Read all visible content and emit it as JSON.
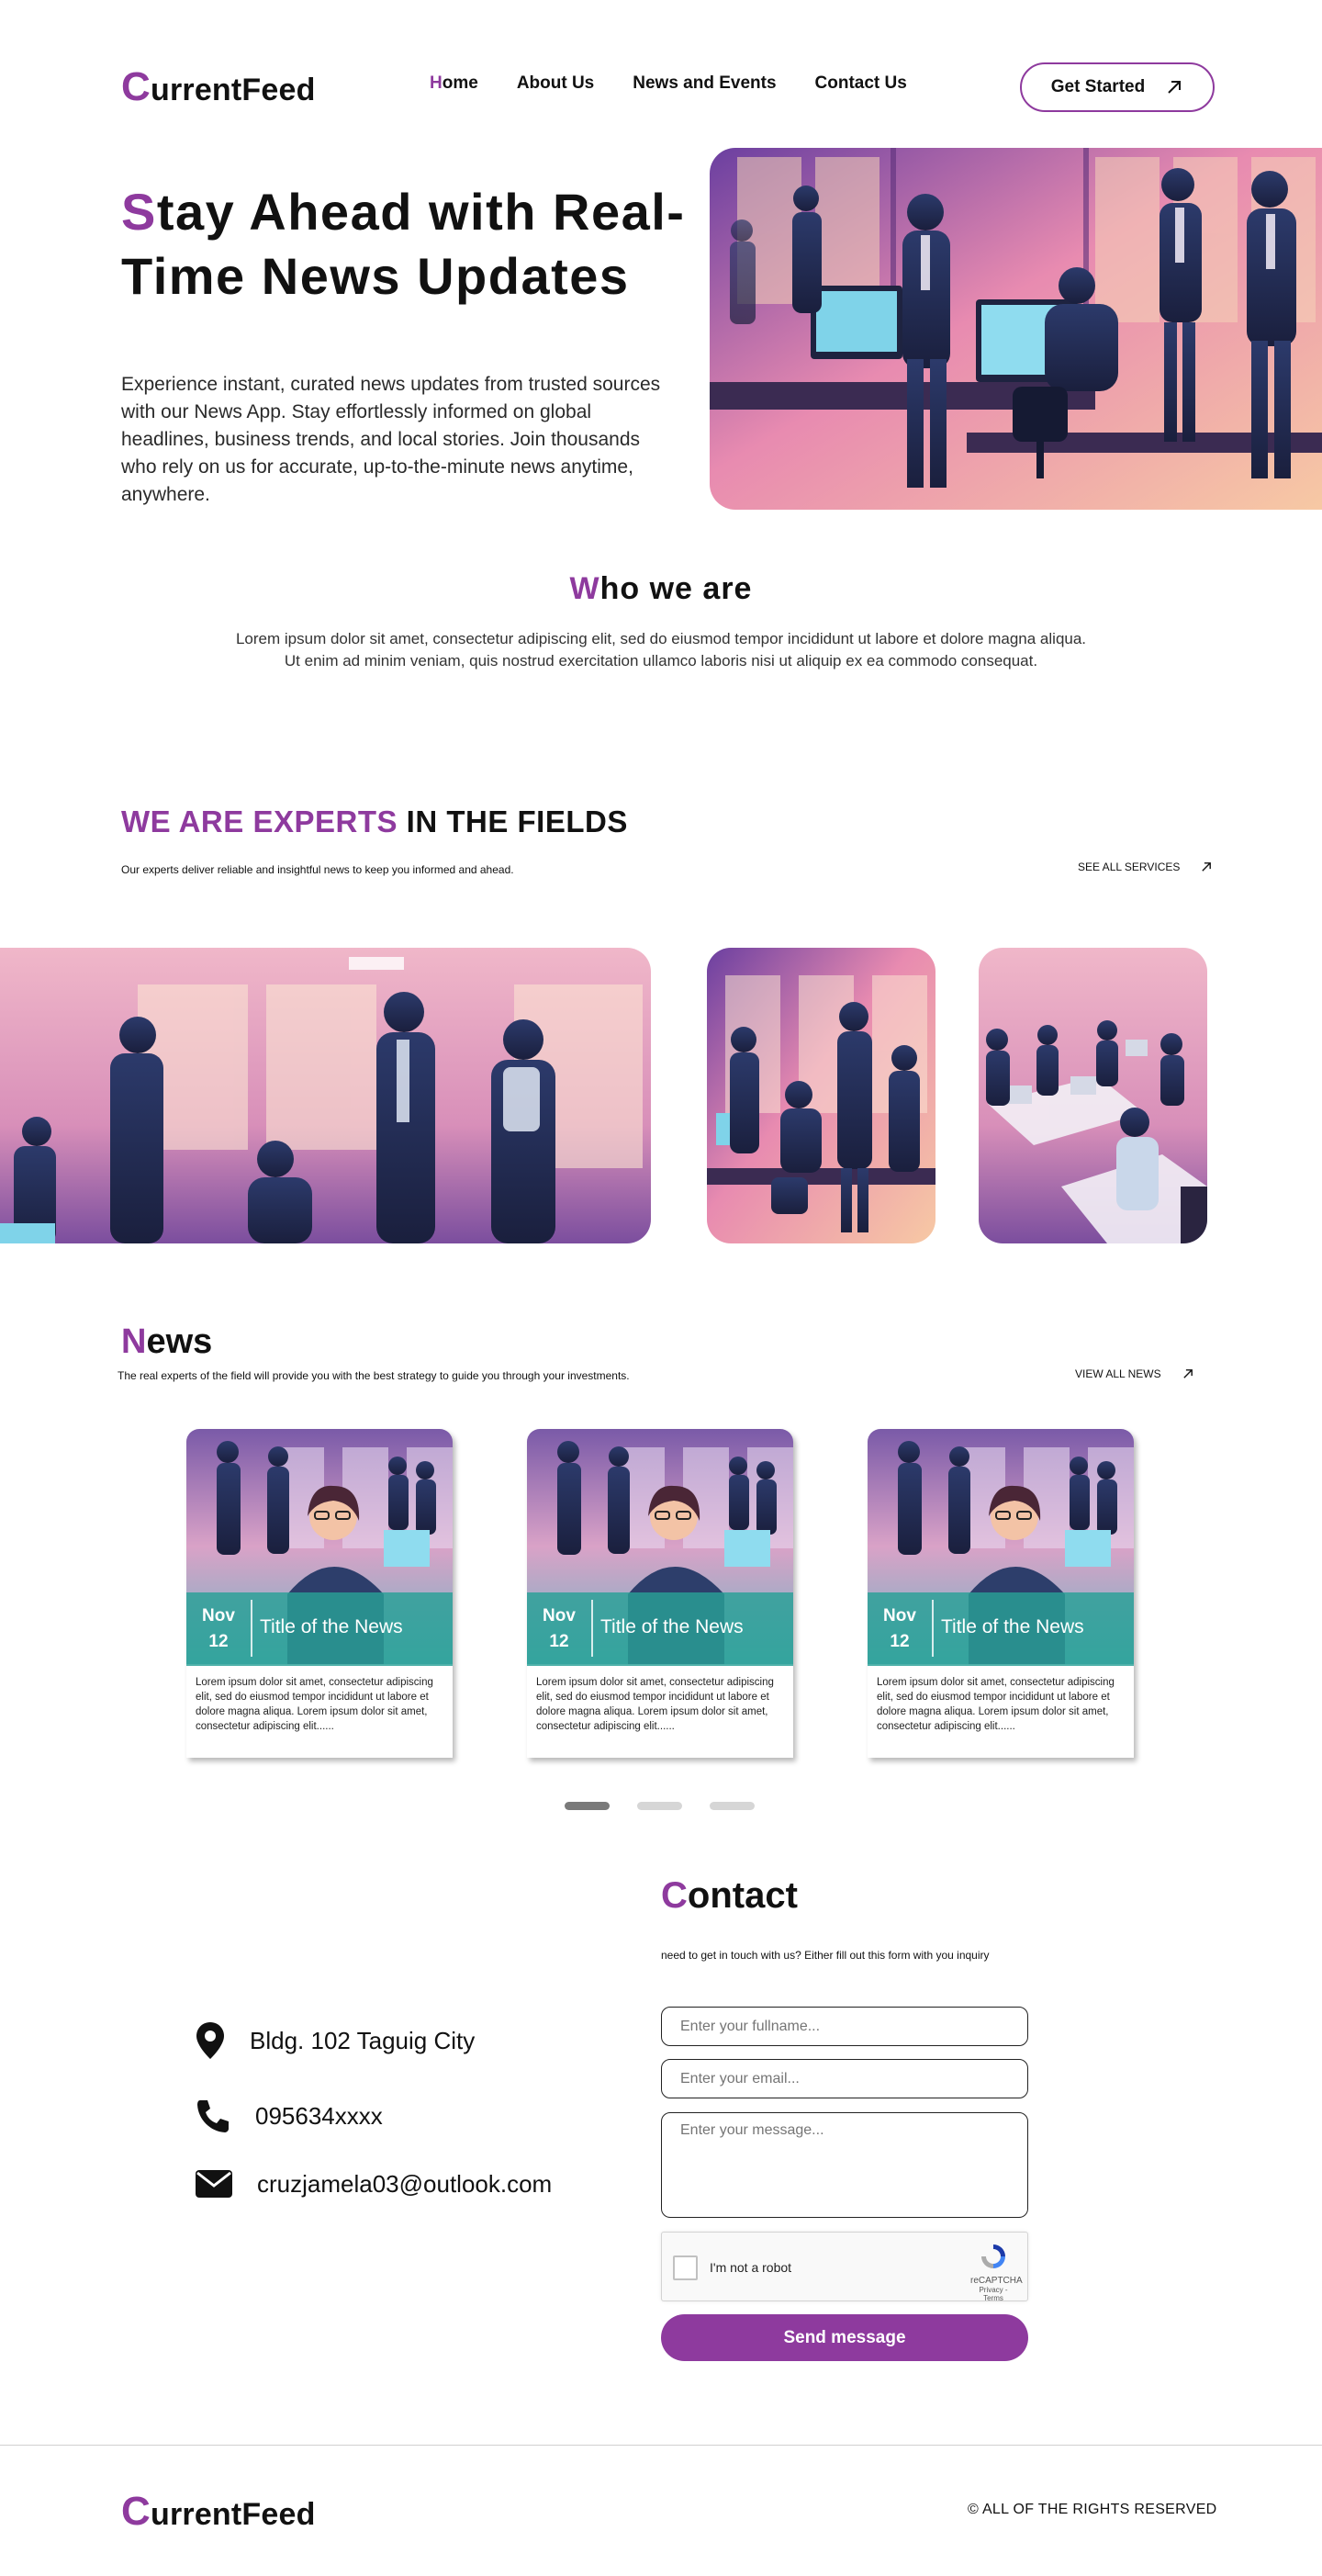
{
  "brand": {
    "first_letter": "C",
    "rest": "urrentFeed"
  },
  "nav": {
    "items": [
      {
        "first": "H",
        "rest": "ome"
      },
      {
        "first": "",
        "rest": "About Us"
      },
      {
        "first": "",
        "rest": "News and Events"
      },
      {
        "first": "",
        "rest": "Contact Us"
      }
    ],
    "cta_label": "Get Started"
  },
  "hero": {
    "title_first": "S",
    "title_rest": "tay Ahead with Real-Time News Updates",
    "description": "Experience instant, curated news updates from trusted sources with our News App. Stay effortlessly informed on global headlines, business trends, and local stories. Join thousands who rely on us for accurate, up-to-the-minute news anytime, anywhere."
  },
  "who": {
    "title_first": "W",
    "title_rest": "ho we are",
    "text": "Lorem ipsum dolor sit amet, consectetur adipiscing elit, sed do eiusmod tempor incididunt ut labore et dolore magna aliqua. Ut enim ad minim veniam, quis nostrud exercitation ullamco laboris nisi ut aliquip ex ea commodo consequat."
  },
  "experts": {
    "title_highlight": "WE ARE EXPERTS",
    "title_rest": " IN THE FIELDS",
    "subtitle": "Our experts deliver reliable and insightful news to keep you informed and ahead.",
    "link_label": "SEE ALL SERVICES"
  },
  "news": {
    "title_first": "N",
    "title_rest": "ews",
    "subtitle": "The real experts of the field will provide you with the best strategy to guide you through your investments.",
    "link_label": "VIEW ALL NEWS",
    "cards": [
      {
        "month": "Nov",
        "day": "12",
        "title": "Title of the News",
        "body": "Lorem ipsum dolor sit amet, consectetur adipiscing elit, sed do eiusmod tempor incididunt ut labore et dolore magna aliqua. Lorem ipsum dolor sit amet, consectetur adipiscing elit......"
      },
      {
        "month": "Nov",
        "day": "12",
        "title": "Title of the News",
        "body": "Lorem ipsum dolor sit amet, consectetur adipiscing elit, sed do eiusmod tempor incididunt ut labore et dolore magna aliqua. Lorem ipsum dolor sit amet, consectetur adipiscing elit......"
      },
      {
        "month": "Nov",
        "day": "12",
        "title": "Title of the News",
        "body": "Lorem ipsum dolor sit amet, consectetur adipiscing elit, sed do eiusmod tempor incididunt ut labore et dolore magna aliqua. Lorem ipsum dolor sit amet, consectetur adipiscing elit......"
      }
    ],
    "carousel_active_index": 0
  },
  "contact": {
    "title_first": "C",
    "title_rest": "ontact",
    "subtitle": "need to get in touch with us? Either fill out this form with you inquiry",
    "address": "Bldg. 102 Taguig City",
    "phone": "095634xxxx",
    "email": "cruzjamela03@outlook.com",
    "placeholders": {
      "fullname": "Enter your fullname...",
      "email": "Enter your email...",
      "message": "Enter your message..."
    },
    "captcha": {
      "label": "I'm not a robot",
      "brand": "reCAPTCHA",
      "links": "Privacy - Terms"
    },
    "send_label": "Send message"
  },
  "footer": {
    "copyright": "© ALL OF THE RIGHTS RESERVED"
  },
  "colors": {
    "accent": "#8e3a9e",
    "teal_band": "#28a096"
  },
  "icons": {
    "cta": "arrow-up-right-icon",
    "address": "map-pin-icon",
    "phone": "phone-icon",
    "email": "envelope-icon"
  }
}
